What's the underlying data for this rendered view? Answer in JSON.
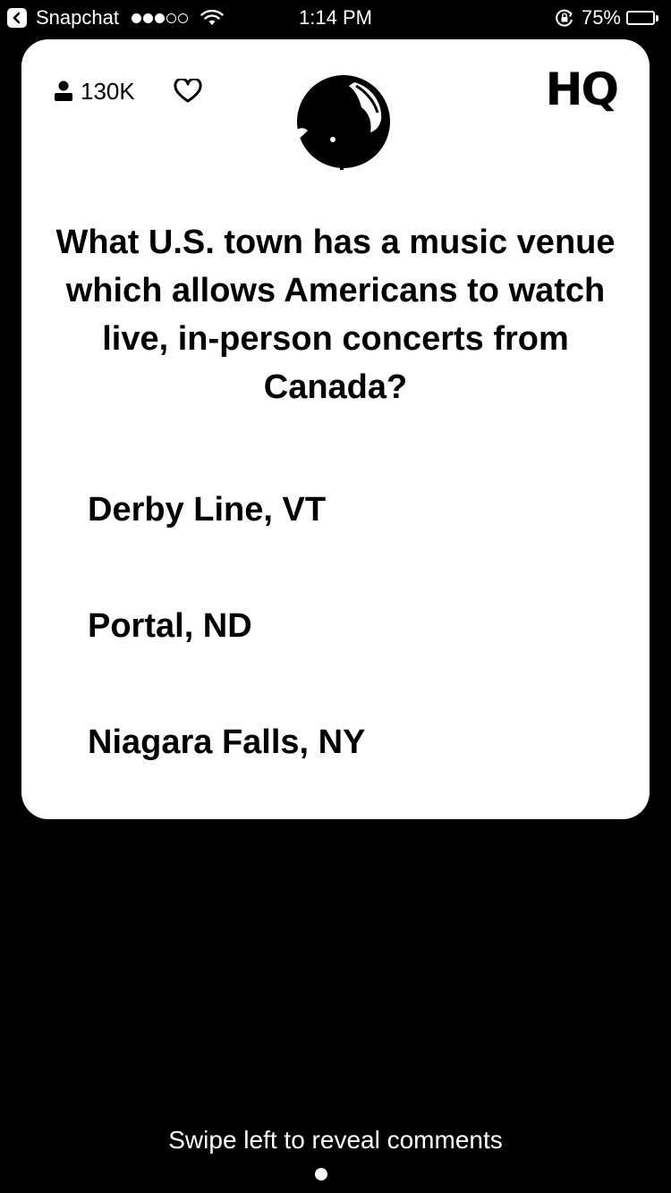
{
  "status_bar": {
    "back_app": "Snapchat",
    "signal_bars": 3,
    "signal_total": 5,
    "time": "1:14 PM",
    "battery_percent_label": "75%",
    "battery_level": 0.75
  },
  "card": {
    "viewer_count": "130K",
    "logo": "HQ",
    "question": "What U.S. town has a music venue which allows Americans to watch live, in-person concerts from Canada?",
    "answers": [
      "Derby Line, VT",
      "Portal, ND",
      "Niagara Falls, NY"
    ]
  },
  "footer": {
    "swipe_hint": "Swipe left to reveal comments"
  },
  "icons": {
    "back": "chevron-left-icon",
    "wifi": "wifi-icon",
    "rotation_lock": "rotation-lock-icon",
    "battery": "battery-icon",
    "viewers": "person-icon",
    "like": "heart-icon"
  },
  "colors": {
    "background": "#000000",
    "card": "#ffffff",
    "text_on_card": "#000000",
    "text_on_background": "#ffffff"
  }
}
